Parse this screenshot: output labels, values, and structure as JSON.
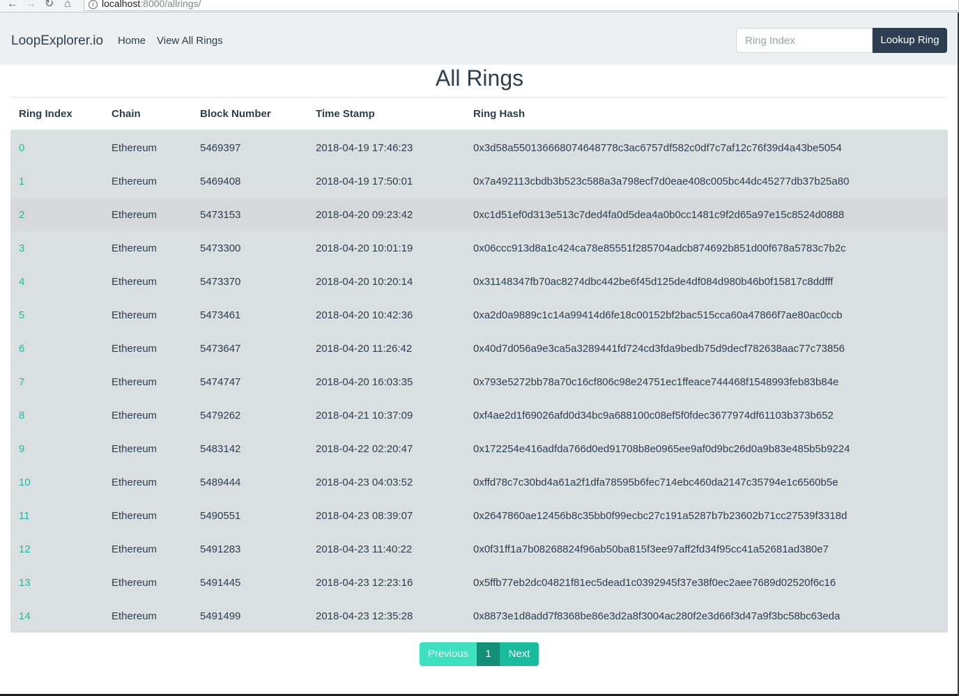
{
  "browser": {
    "url_host": "localhost",
    "url_path": ":8000/allrings/"
  },
  "navbar": {
    "brand": "LoopExplorer.io",
    "links": [
      "Home",
      "View All Rings"
    ],
    "search_placeholder": "Ring Index",
    "lookup_label": "Lookup Ring"
  },
  "page": {
    "title": "All Rings"
  },
  "table": {
    "headers": [
      "Ring Index",
      "Chain",
      "Block Number",
      "Time Stamp",
      "Ring Hash"
    ],
    "rows": [
      {
        "index": "0",
        "chain": "Ethereum",
        "block": "5469397",
        "timestamp": "2018-04-19 17:46:23",
        "hash": "0x3d58a5501366680746487​78c3ac6757df582c0df7c7af12c76f39d4a43be5054"
      },
      {
        "index": "1",
        "chain": "Ethereum",
        "block": "5469408",
        "timestamp": "2018-04-19 17:50:01",
        "hash": "0x7a492113cbdb3b523c588a3a798ecf7d0eae408c005bc44dc45277db37b25a80"
      },
      {
        "index": "2",
        "chain": "Ethereum",
        "block": "5473153",
        "timestamp": "2018-04-20 09:23:42",
        "hash": "0xc1d51ef0d313e513c7ded4fa0d5dea4a0b0cc1481c9f2d65a97e15c8524d0888"
      },
      {
        "index": "3",
        "chain": "Ethereum",
        "block": "5473300",
        "timestamp": "2018-04-20 10:01:19",
        "hash": "0x06ccc913d8a1c424ca78e85551f285704adcb874692b851d00f678a5783c7b2c"
      },
      {
        "index": "4",
        "chain": "Ethereum",
        "block": "5473370",
        "timestamp": "2018-04-20 10:20:14",
        "hash": "0x31148347fb70ac8274dbc442be6f45d125de4df084d980b46b0f15817c8ddfff"
      },
      {
        "index": "5",
        "chain": "Ethereum",
        "block": "5473461",
        "timestamp": "2018-04-20 10:42:36",
        "hash": "0xa2d0a9889c1c14a99414d6fe18c00152bf2bac515cca60a47866f7ae80ac0ccb"
      },
      {
        "index": "6",
        "chain": "Ethereum",
        "block": "5473647",
        "timestamp": "2018-04-20 11:26:42",
        "hash": "0x40d7d056a9e3ca5a3289441fd724cd3fda9bedb75d9decf782638aac77c73856"
      },
      {
        "index": "7",
        "chain": "Ethereum",
        "block": "5474747",
        "timestamp": "2018-04-20 16:03:35",
        "hash": "0x793e5272bb78a70c16cf806c98e24751ec1ffeace744468f1548993feb83b84e"
      },
      {
        "index": "8",
        "chain": "Ethereum",
        "block": "5479262",
        "timestamp": "2018-04-21 10:37:09",
        "hash": "0xf4ae2d1f69026afd0d34bc9a688100c08ef5f0fdec3677974df61103b373b652"
      },
      {
        "index": "9",
        "chain": "Ethereum",
        "block": "5483142",
        "timestamp": "2018-04-22 02:20:47",
        "hash": "0x172254e416adfda766d0ed91708b8e0965ee9af0d9bc26d0a9b83e485b5b9224"
      },
      {
        "index": "10",
        "chain": "Ethereum",
        "block": "5489444",
        "timestamp": "2018-04-23 04:03:52",
        "hash": "0xffd78c7c30bd4a61a2f1dfa78595b6fec714ebc460da2147c35794e1c6560b5e"
      },
      {
        "index": "11",
        "chain": "Ethereum",
        "block": "5490551",
        "timestamp": "2018-04-23 08:39:07",
        "hash": "0x2647860ae12456b8c35bb0f99ecbc27c191a5287b7b23602b71cc27539f3318d"
      },
      {
        "index": "12",
        "chain": "Ethereum",
        "block": "5491283",
        "timestamp": "2018-04-23 11:40:22",
        "hash": "0x0f31ff1a7b08268824f96ab50ba815f3ee97aff2fd34f95cc41a52681ad380e7"
      },
      {
        "index": "13",
        "chain": "Ethereum",
        "block": "5491445",
        "timestamp": "2018-04-23 12:23:16",
        "hash": "0x5ffb77eb2dc04821f81ec5dead1c0392945f37e38f0ec2aee7689d02520f6c16"
      },
      {
        "index": "14",
        "chain": "Ethereum",
        "block": "5491499",
        "timestamp": "2018-04-23 12:35:28",
        "hash": "0x8873e1d8add7f8368be86e3d2a8f3004ac280f2e3d66f3d47a9f3bc58bc63eda"
      }
    ],
    "highlighted_row": 2
  },
  "pagination": {
    "previous_label": "Previous",
    "current_page": "1",
    "next_label": "Next"
  },
  "colors": {
    "primary": "#2c3e50",
    "accent": "#18bc9c",
    "navbar_bg": "#ecf0f1",
    "row_bg": "#dadfe2"
  }
}
